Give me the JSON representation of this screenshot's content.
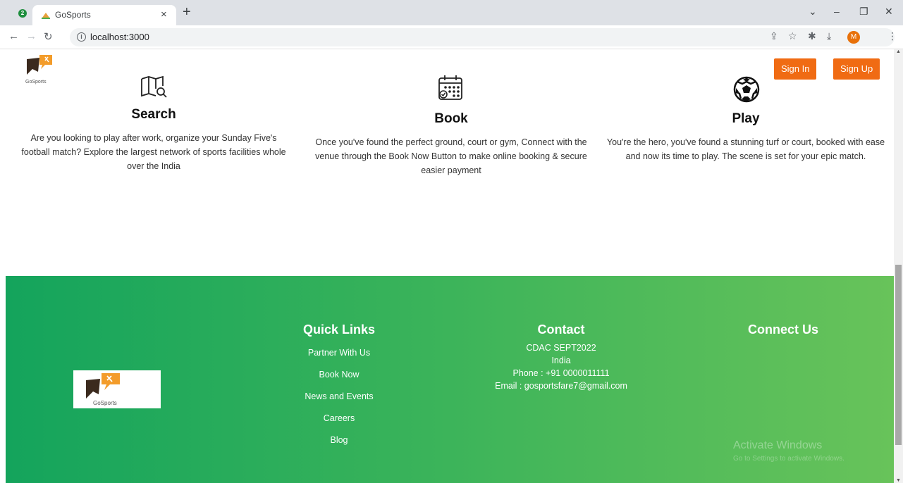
{
  "browser": {
    "profile_badge": "2",
    "tab_title": "GoSports",
    "tab_close": "×",
    "new_tab": "+",
    "url": "localhost:3000",
    "avatar_initial": "M"
  },
  "header": {
    "logo_text": "GoSports",
    "signin_label": "Sign In",
    "signup_label": "Sign Up"
  },
  "features": [
    {
      "icon": "map-search-icon",
      "title": "Search",
      "text": "Are you looking to play after work, organize your Sunday Five's football match? Explore the largest network of sports facilities whole over the India"
    },
    {
      "icon": "calendar-icon",
      "title": "Book",
      "text": "Once you've found the perfect ground, court or gym, Connect with the venue through the Book Now Button to make online booking & secure easier payment"
    },
    {
      "icon": "soccer-ball-icon",
      "title": "Play",
      "text": "You're the hero, you've found a stunning turf or court, booked with ease and now its time to play. The scene is set for your epic match."
    }
  ],
  "footer": {
    "logo_text": "GoSports",
    "quick_links": {
      "title": "Quick Links",
      "items": [
        "Partner With Us",
        "Book Now",
        "News and Events",
        "Careers",
        "Blog"
      ]
    },
    "contact": {
      "title": "Contact",
      "lines": [
        "CDAC SEPT2022",
        "India",
        "Phone : +91 0000011111",
        "Email : gosportsfare7@gmail.com"
      ]
    },
    "connect": {
      "title": "Connect Us"
    },
    "watermark_title": "Activate Windows",
    "watermark_sub": "Go to Settings to activate Windows."
  },
  "colors": {
    "accent": "#f06b13",
    "footer_start": "#14a45c",
    "footer_end": "#68c35a"
  }
}
